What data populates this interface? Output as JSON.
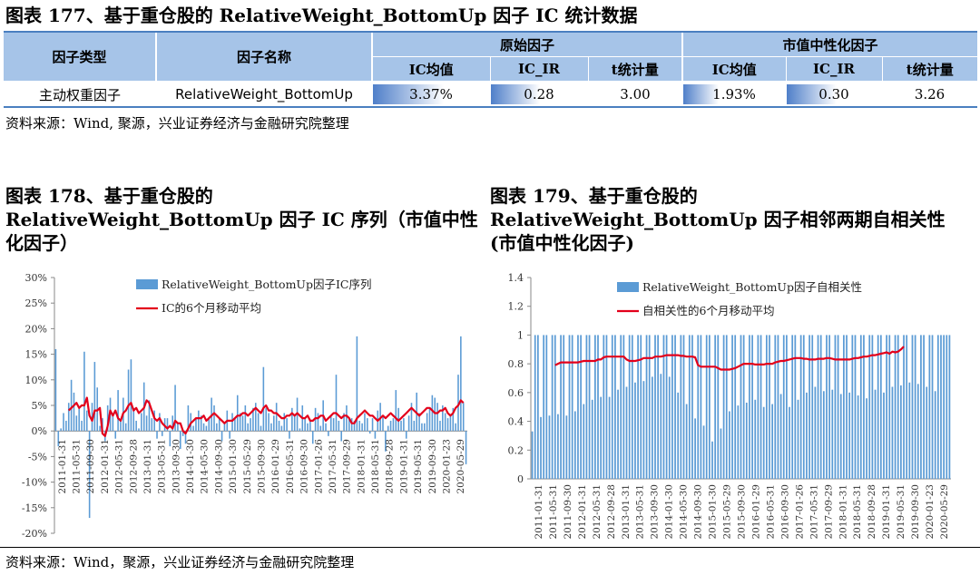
{
  "table_title": "图表 177、基于重仓股的 RelativeWeight_BottomUp 因子 IC 统计数据",
  "table": {
    "col_factor_type": "因子类型",
    "col_factor_name": "因子名称",
    "group_raw": "原始因子",
    "group_neutral": "市值中性化因子",
    "sub_headers": [
      "IC均值",
      "IC_IR",
      "t统计量",
      "IC均值",
      "IC_IR",
      "t统计量"
    ],
    "row": {
      "type": "主动权重因子",
      "name": "RelativeWeight_BottomUp",
      "values": [
        "3.37%",
        "0.28",
        "3.00",
        "1.93%",
        "0.30",
        "3.26"
      ],
      "bar_fractions": [
        0.6,
        0.5,
        0.0,
        0.34,
        0.52,
        0.0
      ]
    }
  },
  "source_1": "资料来源：Wind, 聚源，兴业证券经济与金融研究院整理",
  "chart1_title": [
    "图表 178、基于重仓股的",
    "RelativeWeight_BottomUp 因子 IC 序列（市值中性",
    "化因子）"
  ],
  "chart2_title": [
    "图表 179、基于重仓股的",
    "RelativeWeight_BottomUp 因子相邻两期自相关性",
    "(市值中性化因子)"
  ],
  "source_2": "资料来源：Wind，聚源，兴业证券经济与金融研究院整理",
  "colors": {
    "bar": "#5b9bd5",
    "line": "#e3001b",
    "header": "#a6c4e8",
    "rule": "#4a7fc0"
  },
  "chart_data": [
    {
      "type": "bar",
      "legend": [
        "RelativeWeight_BottomUp因子IC序列",
        "IC的6个月移动平均"
      ],
      "ylim": [
        -0.2,
        0.3
      ],
      "yticks": [
        -0.2,
        -0.15,
        -0.1,
        -0.05,
        0,
        0.05,
        0.1,
        0.15,
        0.2,
        0.25,
        0.3
      ],
      "ytick_labels": [
        "-20%",
        "-15%",
        "-10%",
        "-5%",
        "0%",
        "5%",
        "10%",
        "15%",
        "20%",
        "25%",
        "30%"
      ],
      "xtick_labels": [
        "2011-01-31",
        "2011-05-31",
        "2011-09-30",
        "2012-01-31",
        "2012-05-31",
        "2012-09-28",
        "2013-01-31",
        "2013-05-31",
        "2013-09-30",
        "2014-01-30",
        "2014-05-30",
        "2014-09-30",
        "2015-01-30",
        "2015-05-29",
        "2015-09-30",
        "2016-01-29",
        "2016-05-31",
        "2016-09-30",
        "2017-01-26",
        "2017-05-31",
        "2017-09-29",
        "2018-01-31",
        "2018-05-31",
        "2018-09-28",
        "2019-01-31",
        "2019-05-31",
        "2019-09-30",
        "2020-01-23",
        "2020-05-29"
      ],
      "series": [
        {
          "name": "RelativeWeight_BottomUp因子IC序列",
          "values": [
            0.16,
            -0.03,
            0.005,
            0.035,
            0.02,
            0.055,
            0.1,
            0.075,
            0.03,
            0.045,
            0.02,
            0.155,
            0.04,
            -0.17,
            0.055,
            0.135,
            0.085,
            0.01,
            0.025,
            -0.02,
            0.05,
            0.065,
            0.035,
            -0.015,
            0.08,
            0.02,
            0.065,
            0.015,
            0.12,
            0.14,
            0.045,
            0.02,
            0.005,
            0.035,
            0.095,
            0.03,
            0.06,
            0.025,
            0.04,
            -0.015,
            0.035,
            -0.01,
            0.025,
            0.025,
            -0.03,
            0.03,
            0.09,
            0.015,
            -0.035,
            -0.01,
            -0.025,
            0.05,
            0.035,
            0.01,
            0.025,
            0.04,
            0.03,
            0.015,
            0.01,
            0.025,
            0.065,
            0.05,
            0.015,
            0.025,
            -0.02,
            0.015,
            0.04,
            -0.015,
            0.035,
            0.025,
            0.07,
            0.035,
            0.03,
            0.05,
            0.015,
            0.025,
            0.045,
            0.055,
            0.035,
            0.01,
            0.125,
            0.045,
            0.035,
            0.015,
            0.03,
            0.055,
            0.02,
            0.01,
            0.035,
            0.025,
            -0.015,
            0.045,
            0.03,
            0.065,
            0.005,
            0.05,
            0.025,
            0.015,
            0.02,
            -0.025,
            0.045,
            0.035,
            0.01,
            0.06,
            0.015,
            -0.01,
            0.03,
            0.025,
            0.11,
            0.02,
            -0.02,
            0.035,
            0.05,
            0.025,
            0.025,
            0.02,
            0.185,
            0.02,
            0.015,
            0.035,
            0.025,
            -0.005,
            0.025,
            -0.015,
            0.04,
            0.055,
            0.03,
            -0.04,
            0.01,
            0.02,
            0.025,
            0.08,
            0.045,
            0.02,
            0.025,
            -0.015,
            0.03,
            0.055,
            0.02,
            0.075,
            0.035,
            0.015,
            0.015,
            0.035,
            0.045,
            0.07,
            0.065,
            0.055,
            0.02,
            0.05,
            0.035,
            0.025,
            0.03,
            0.045,
            0.015,
            0.11,
            0.185,
            0.055,
            -0.065
          ]
        },
        {
          "name": "IC的6个月移动平均",
          "values": [
            null,
            null,
            null,
            null,
            null,
            0.04,
            0.045,
            0.05,
            0.055,
            0.045,
            0.05,
            0.05,
            0.065,
            0.03,
            0.02,
            0.04,
            0.04,
            0.045,
            -0.005,
            -0.01,
            0.01,
            0.04,
            0.03,
            0.04,
            0.025,
            0.02,
            0.035,
            0.04,
            0.05,
            0.055,
            0.04,
            0.045,
            0.035,
            0.04,
            0.045,
            0.06,
            0.055,
            0.04,
            0.025,
            0.02,
            0.025,
            0.015,
            0.01,
            0.005,
            0.01,
            0.005,
            0.02,
            0.015,
            0.015,
            0.0,
            -0.005,
            0.005,
            0.015,
            0.02,
            0.025,
            0.025,
            0.025,
            0.03,
            0.02,
            0.025,
            0.03,
            0.035,
            0.03,
            0.025,
            0.02,
            0.015,
            0.02,
            0.02,
            0.02,
            0.025,
            0.03,
            0.03,
            0.035,
            0.035,
            0.03,
            0.035,
            0.04,
            0.045,
            0.04,
            0.035,
            0.045,
            0.05,
            0.04,
            0.04,
            0.035,
            0.035,
            0.03,
            0.025,
            0.025,
            0.03,
            0.03,
            0.035,
            0.03,
            0.035,
            0.03,
            0.025,
            0.025,
            0.03,
            0.02,
            0.02,
            0.025,
            0.025,
            0.03,
            0.03,
            0.02,
            0.025,
            0.03,
            0.035,
            0.035,
            0.03,
            0.025,
            0.03,
            0.03,
            0.025,
            0.015,
            0.015,
            0.025,
            0.03,
            0.035,
            0.04,
            0.035,
            0.03,
            0.03,
            0.025,
            0.02,
            0.025,
            0.03,
            0.025,
            0.03,
            0.035,
            0.03,
            0.025,
            0.02,
            0.025,
            0.03,
            0.035,
            0.04,
            0.045,
            0.04,
            0.035,
            0.03,
            0.035,
            0.04,
            0.045,
            0.045,
            0.04,
            0.035,
            0.035,
            0.04,
            0.04,
            0.045,
            0.035,
            0.03,
            0.035,
            0.045,
            0.05,
            0.06,
            0.055
          ]
        }
      ]
    },
    {
      "type": "bar",
      "legend": [
        "RelativeWeight_BottomUp因子自相关性",
        "自相关性的6个月移动平均"
      ],
      "ylim": [
        0,
        1.4
      ],
      "yticks": [
        0,
        0.2,
        0.4,
        0.6,
        0.8,
        1,
        1.2,
        1.4
      ],
      "ytick_labels": [
        "0",
        "0.2",
        "0.4",
        "0.6",
        "0.8",
        "1",
        "1.2",
        "1.4"
      ],
      "xtick_labels": [
        "2011-01-31",
        "2011-05-31",
        "2011-09-30",
        "2012-01-31",
        "2012-05-31",
        "2012-09-28",
        "2013-01-31",
        "2013-05-31",
        "2013-09-30",
        "2014-01-30",
        "2014-05-30",
        "2014-09-30",
        "2015-01-30",
        "2015-05-29",
        "2015-09-30",
        "2016-01-29",
        "2016-05-31",
        "2016-09-30",
        "2017-01-26",
        "2017-05-31",
        "2017-09-29",
        "2018-01-31",
        "2018-05-31",
        "2018-09-28",
        "2019-01-31",
        "2019-05-31",
        "2019-09-30",
        "2020-01-23",
        "2020-05-29"
      ],
      "series": [
        {
          "name": "RelativeWeight_BottomUp因子自相关性",
          "values": [
            0.33,
            1,
            1,
            0.43,
            1,
            1,
            0.44,
            1,
            1,
            0.45,
            1,
            1,
            0.44,
            1,
            1,
            0.47,
            1,
            1,
            0.52,
            1,
            1,
            0.55,
            1,
            1,
            0.57,
            1,
            1,
            0.57,
            1,
            1,
            0.62,
            1,
            1,
            0.64,
            1,
            1,
            0.67,
            1,
            1,
            0.68,
            1,
            1,
            0.71,
            1,
            1,
            0.73,
            1,
            1,
            0.71,
            1,
            1,
            0.6,
            1,
            1,
            0.52,
            1,
            1,
            0.42,
            1,
            1,
            0.37,
            1,
            1,
            0.26,
            1,
            1,
            0.35,
            1,
            1,
            0.47,
            1,
            1,
            0.51,
            1,
            1,
            0.53,
            1,
            1,
            0.55,
            1,
            1,
            0.5,
            1,
            1,
            0.52,
            1,
            1,
            0.59,
            1,
            1,
            0.5,
            1,
            1,
            0.55,
            1,
            1,
            0.6,
            1,
            1,
            0.64,
            1,
            1,
            0.61,
            1,
            1,
            0.62,
            1,
            1,
            0.59,
            1,
            1,
            0.6,
            1,
            1,
            0.58,
            1,
            1,
            0.56,
            1,
            1,
            0.62,
            1,
            1,
            0.6,
            1,
            1,
            0.64,
            1,
            1,
            0.65,
            1,
            1,
            0.67,
            1,
            1,
            0.66,
            1,
            1,
            0.64,
            1,
            1,
            0.61,
            1,
            1,
            1,
            1,
            1
          ]
        },
        {
          "name": "自相关性的6个月移动平均",
          "values": [
            null,
            null,
            null,
            null,
            null,
            null,
            null,
            null,
            0.79,
            0.8,
            0.81,
            0.81,
            0.81,
            0.81,
            0.81,
            0.81,
            0.81,
            0.815,
            0.82,
            0.82,
            0.82,
            0.82,
            0.82,
            0.83,
            0.83,
            0.845,
            0.85,
            0.85,
            0.85,
            0.85,
            0.85,
            0.85,
            0.85,
            0.83,
            0.82,
            0.82,
            0.82,
            0.825,
            0.83,
            0.84,
            0.84,
            0.84,
            0.84,
            0.85,
            0.85,
            0.85,
            0.855,
            0.86,
            0.86,
            0.86,
            0.86,
            0.86,
            0.855,
            0.855,
            0.85,
            0.85,
            0.85,
            0.845,
            0.79,
            0.78,
            0.78,
            0.78,
            0.78,
            0.78,
            0.78,
            0.77,
            0.76,
            0.76,
            0.76,
            0.76,
            0.765,
            0.77,
            0.78,
            0.79,
            0.8,
            0.8,
            0.8,
            0.8,
            0.795,
            0.795,
            0.795,
            0.795,
            0.8,
            0.8,
            0.8,
            0.81,
            0.815,
            0.82,
            0.82,
            0.825,
            0.83,
            0.835,
            0.84,
            0.84,
            0.84,
            0.835,
            0.835,
            0.83,
            0.83,
            0.83,
            0.835,
            0.835,
            0.835,
            0.84,
            0.84,
            0.835,
            0.83,
            0.83,
            0.83,
            0.83,
            0.83,
            0.83,
            0.835,
            0.84,
            0.84,
            0.845,
            0.85,
            0.85,
            0.855,
            0.86,
            0.86,
            0.865,
            0.87,
            0.875,
            0.88,
            0.87,
            0.885,
            0.88,
            0.885,
            0.9,
            0.92
          ]
        }
      ]
    }
  ]
}
